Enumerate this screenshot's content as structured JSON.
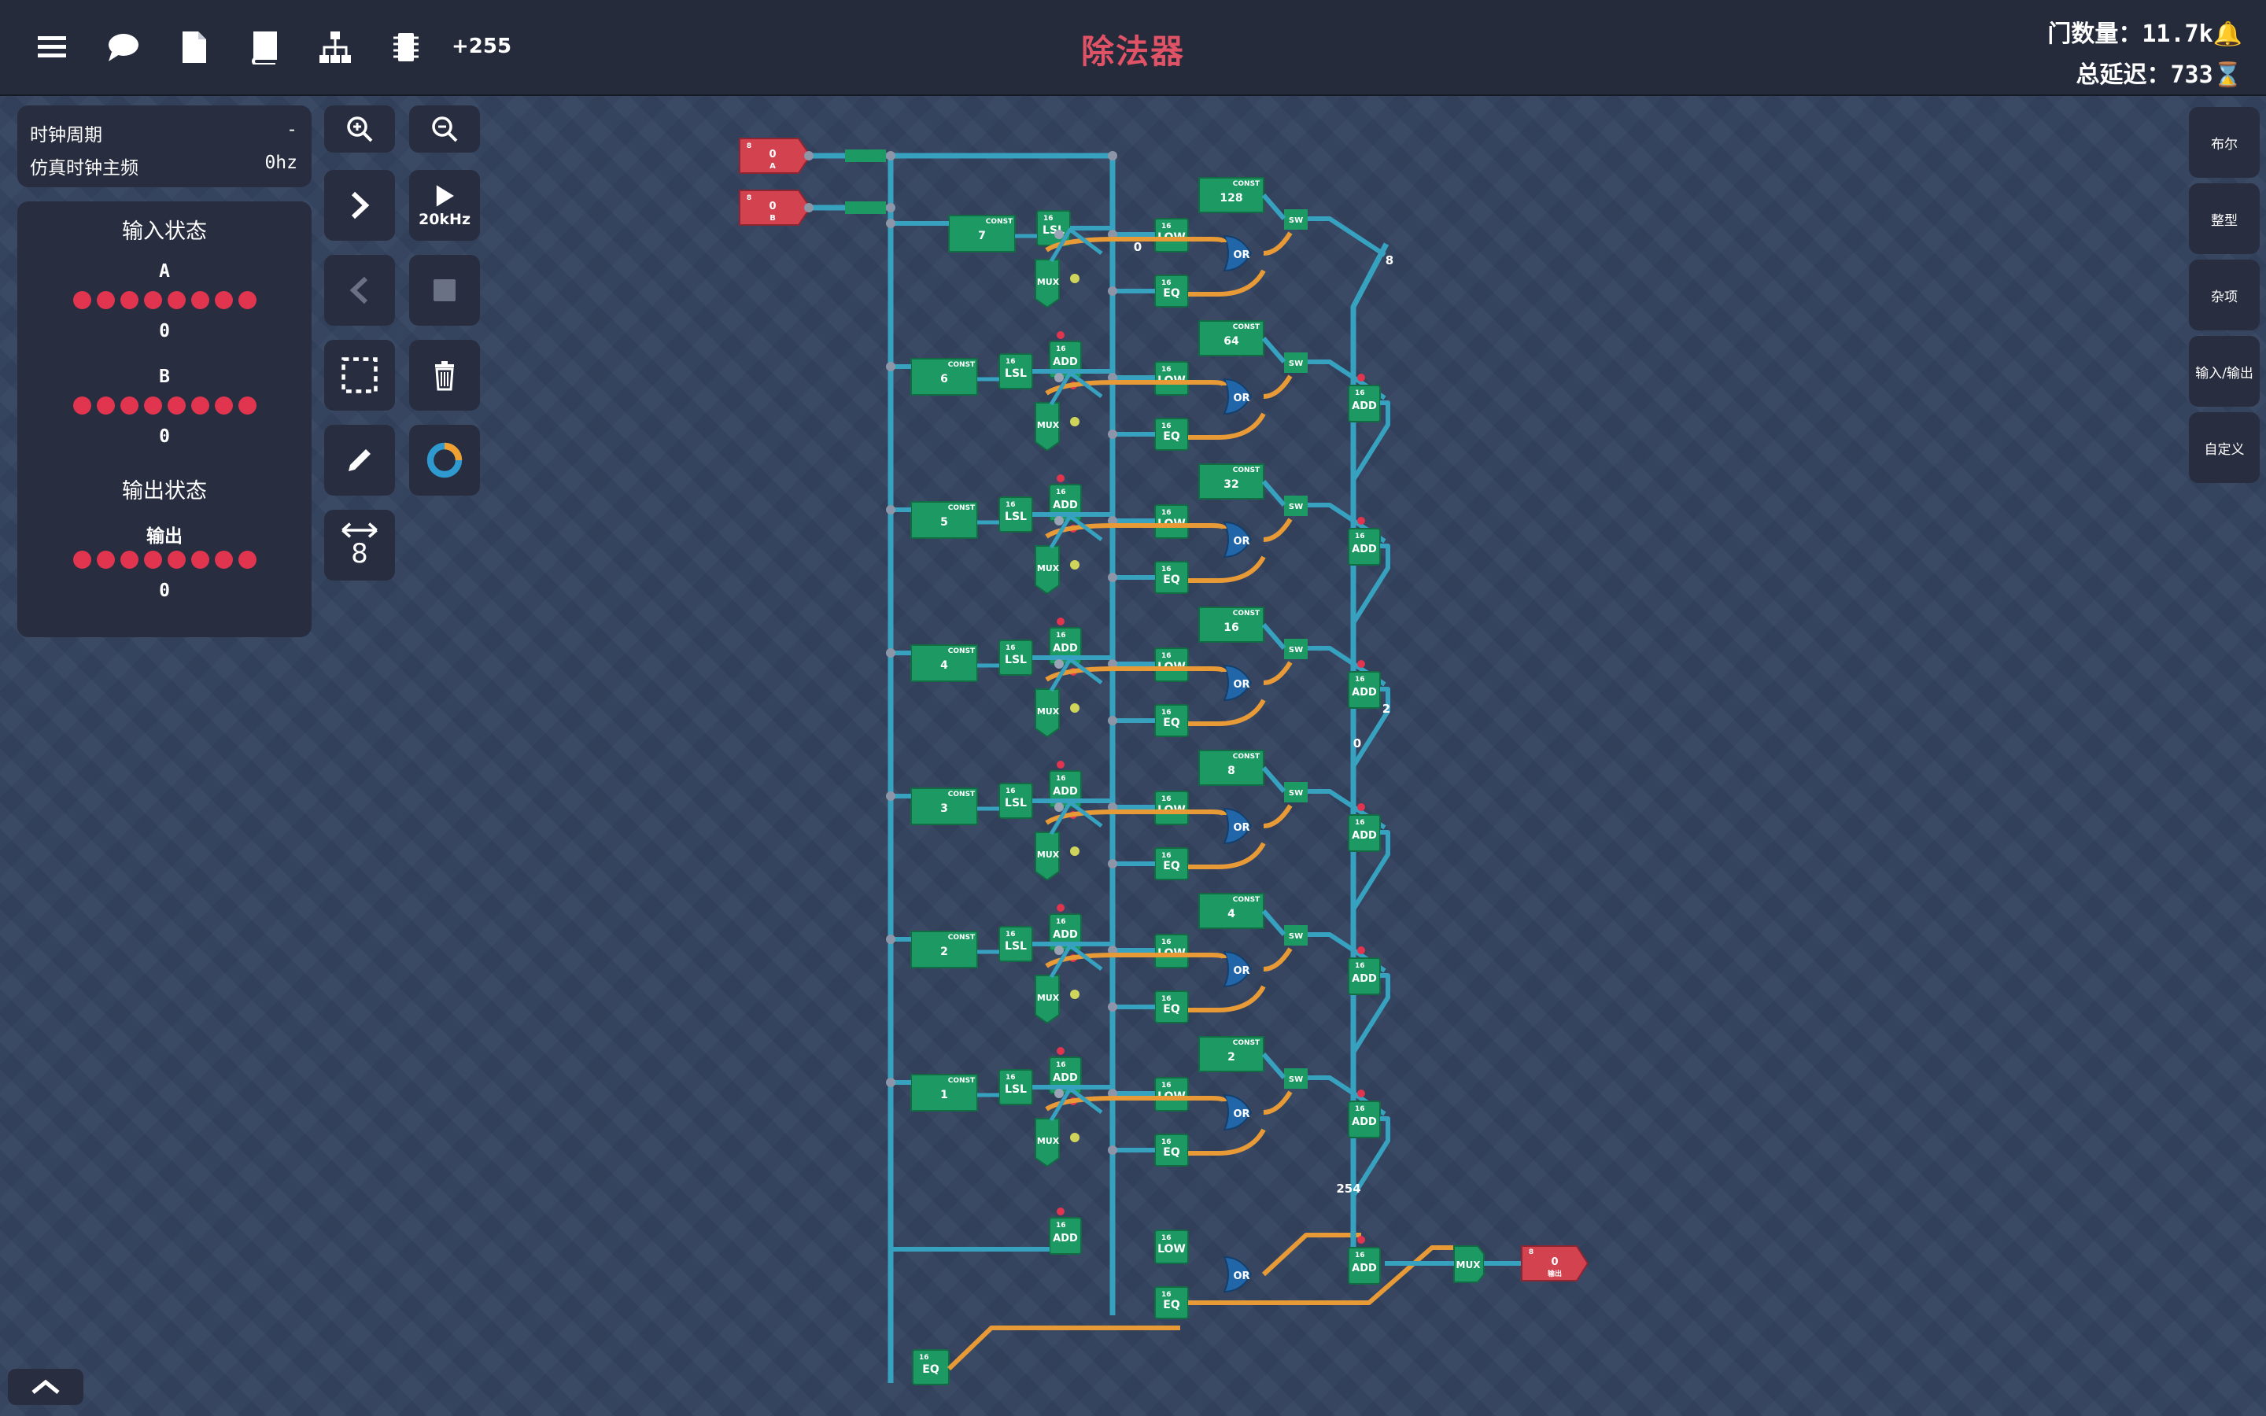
{
  "header": {
    "title": "除法器",
    "count_badge": "+255",
    "gate_count_label": "门数量：",
    "gate_count_value": "11.7k",
    "delay_label": "总延迟：",
    "delay_value": "733",
    "icons": [
      "menu-icon",
      "chat-icon",
      "document-icon",
      "book-icon",
      "hierarchy-icon",
      "chip-icon"
    ]
  },
  "clock": {
    "period_label": "时钟周期",
    "period_value": "-",
    "freq_label": "仿真时钟主频",
    "freq_value": "0hz"
  },
  "io": {
    "input_title": "输入状态",
    "output_title": "输出状态",
    "inputs": [
      {
        "name": "A",
        "bits": 8,
        "value": "0"
      },
      {
        "name": "B",
        "bits": 8,
        "value": "0"
      }
    ],
    "output": {
      "name": "输出",
      "bits": 8,
      "value": "0"
    }
  },
  "tools": {
    "speed_label": "20kHz",
    "bit_width_label": "8"
  },
  "right_menu": [
    "布尔",
    "整型",
    "杂项",
    "输入/输出",
    "自定义"
  ],
  "circuit": {
    "input_a": {
      "width": "8",
      "value": "0",
      "name": "A"
    },
    "input_b": {
      "width": "8",
      "value": "0",
      "name": "B"
    },
    "output": {
      "width": "8",
      "value": "0",
      "name": "输出"
    },
    "stage_shift_consts": [
      "7",
      "6",
      "5",
      "4",
      "3",
      "2",
      "1"
    ],
    "stage_bit_consts": [
      "128",
      "64",
      "32",
      "16",
      "8",
      "4",
      "2"
    ],
    "gate_labels": {
      "lsl": "LSL",
      "add": "ADD",
      "low": "LOW",
      "eq": "EQ",
      "or": "OR",
      "mux": "MUX",
      "sw": "SW",
      "const": "CONST"
    },
    "wire_values": [
      "0",
      "8",
      "254",
      "2",
      "0"
    ],
    "colors": {
      "wire_main": "#36a2c0",
      "wire_ctrl": "#e79a36",
      "gate": "#1d9a63",
      "io": "#d2424f",
      "or_gate": "#2166a8"
    }
  }
}
